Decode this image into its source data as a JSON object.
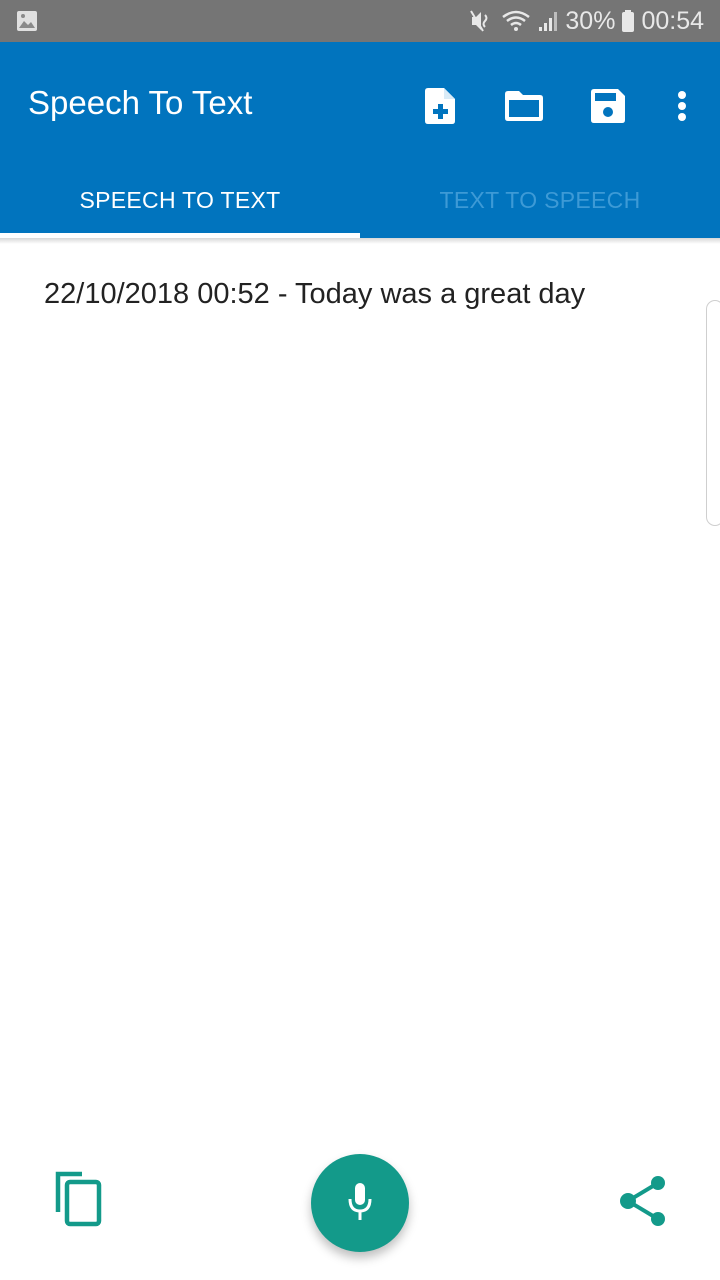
{
  "status_bar": {
    "notification_icon": "image-icon",
    "icons": [
      "mute-vibrate-icon",
      "wifi-icon",
      "signal-icon",
      "battery-icon"
    ],
    "battery": "30%",
    "time": "00:54"
  },
  "app_bar": {
    "title": "Speech To Text",
    "actions": [
      {
        "name": "new-file",
        "icon": "note-add-icon"
      },
      {
        "name": "open-folder",
        "icon": "folder-icon"
      },
      {
        "name": "save",
        "icon": "save-icon"
      },
      {
        "name": "more-options",
        "icon": "more-vert-icon"
      }
    ],
    "color": "#0174be"
  },
  "tabs": [
    {
      "label": "SPEECH TO TEXT",
      "active": true
    },
    {
      "label": "TEXT TO SPEECH",
      "active": false
    }
  ],
  "content": {
    "entries": [
      "22/10/2018 00:52 - Today was a great day"
    ]
  },
  "bottom_bar": {
    "copy": {
      "icon": "copy-icon"
    },
    "mic": {
      "icon": "mic-icon"
    },
    "share": {
      "icon": "share-icon"
    },
    "accent_color": "#139a8a"
  }
}
